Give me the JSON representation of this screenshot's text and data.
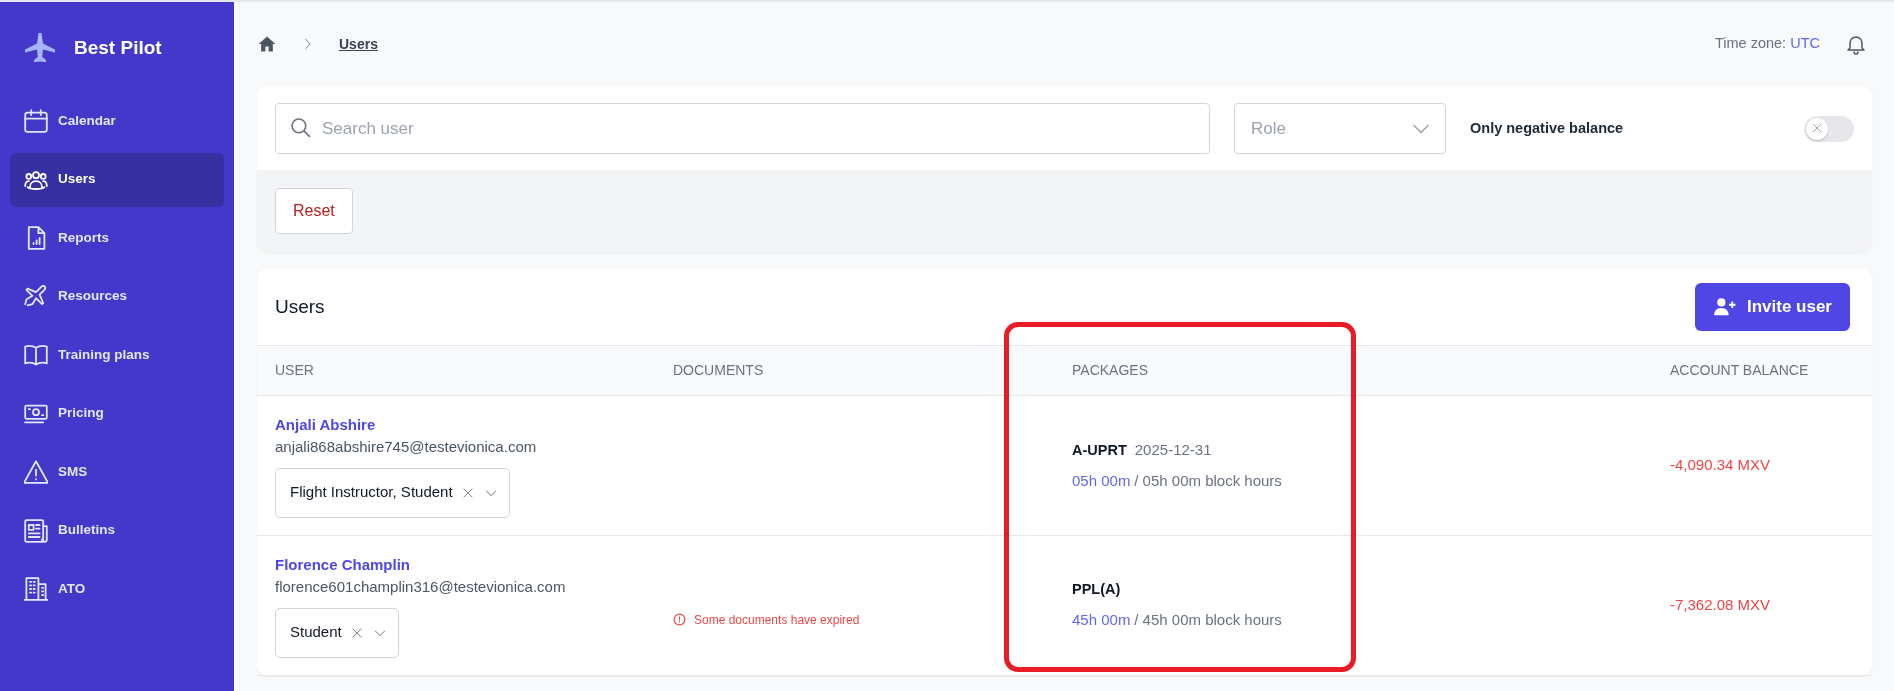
{
  "brand": {
    "name": "Best Pilot"
  },
  "sidebar": {
    "items": [
      {
        "label": "Calendar",
        "selected": false
      },
      {
        "label": "Users",
        "selected": true
      },
      {
        "label": "Reports",
        "selected": false
      },
      {
        "label": "Resources",
        "selected": false
      },
      {
        "label": "Training plans",
        "selected": false
      },
      {
        "label": "Pricing",
        "selected": false
      },
      {
        "label": "SMS",
        "selected": false
      },
      {
        "label": "Bulletins",
        "selected": false
      },
      {
        "label": "ATO",
        "selected": false
      }
    ]
  },
  "breadcrumb": {
    "current": "Users"
  },
  "timezone": {
    "label": "Time zone:",
    "value": "UTC"
  },
  "filters": {
    "search": {
      "placeholder": "Search user"
    },
    "role": {
      "placeholder": "Role"
    },
    "negative_balance": {
      "label": "Only negative balance",
      "on": false
    },
    "reset": "Reset"
  },
  "users_card": {
    "title": "Users",
    "invite_button": "Invite user",
    "columns": [
      "USER",
      "DOCUMENTS",
      "PACKAGES",
      "ACCOUNT BALANCE"
    ],
    "rows": [
      {
        "name": "Anjali Abshire",
        "email": "anjali868abshire745@testevionica.com",
        "roles": "Flight Instructor, Student",
        "documents": null,
        "package": {
          "name": "A-UPRT",
          "date": "2025-12-31",
          "used": "05h 00m",
          "total": "/ 05h 00m block hours"
        },
        "balance": "-4,090.34 MXV"
      },
      {
        "name": "Florence Champlin",
        "email": "florence601champlin316@testevionica.com",
        "roles": "Student",
        "documents": "Some documents have expired",
        "package": {
          "name": "PPL(A)",
          "used": "45h 00m",
          "total": "/ 45h 00m block hours"
        },
        "balance": "-7,362.08 MXV"
      }
    ]
  },
  "annotation": {
    "kind": "rounded-rectangle"
  }
}
